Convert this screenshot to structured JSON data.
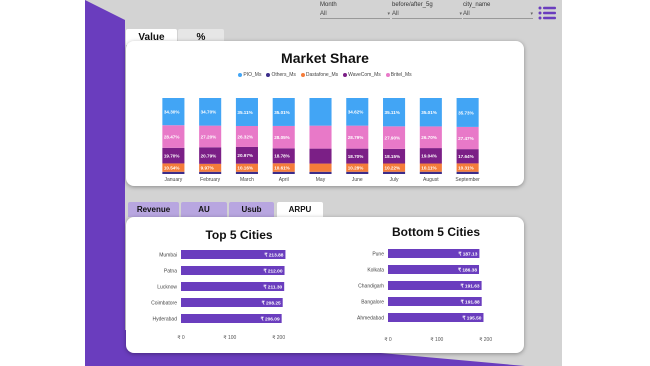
{
  "filters": [
    {
      "label": "Month",
      "value": "All"
    },
    {
      "label": "before/after_5g",
      "value": "All"
    },
    {
      "label": "city_name",
      "value": "All"
    }
  ],
  "top_tabs": [
    "Value",
    "%"
  ],
  "bottom_tabs": [
    "Revenue",
    "AU",
    "Usub",
    "ARPU"
  ],
  "colors": {
    "purple": "#6a3dbe",
    "bar": "#6a3dbe",
    "pio": "#42a5f5",
    "others": "#3b2d8a",
    "dastafone": "#f57c3a",
    "wavecom": "#7b1f86",
    "britel": "#e879c8"
  },
  "chart_data": [
    {
      "type": "bar",
      "title": "Market Share",
      "stacked": true,
      "legend_position": "top",
      "categories": [
        "January",
        "February",
        "March",
        "April",
        "May",
        "June",
        "July",
        "August",
        "September"
      ],
      "series": [
        {
          "name": "PIO_Ms",
          "color": "#42a5f5",
          "values": [
            34.3,
            34.7,
            35.11,
            35.01,
            34.7,
            34.62,
            35.11,
            35.01,
            35.73
          ]
        },
        {
          "name": "Others_Ms",
          "color": "#3b2d8a",
          "values": [
            2.79,
            2.79,
            2.79,
            2.79,
            2.79,
            2.79,
            2.79,
            2.79,
            2.79
          ]
        },
        {
          "name": "Dastafone_Ms",
          "color": "#f57c3a",
          "values": [
            10.54,
            9.97,
            10.16,
            10.61,
            10.28,
            10.28,
            10.22,
            10.11,
            10.31
          ]
        },
        {
          "name": "WaveCom_Ms",
          "color": "#7b1f86",
          "values": [
            19.7,
            20.79,
            20.97,
            18.78,
            18.78,
            18.7,
            18.15,
            19.04,
            17.64
          ]
        },
        {
          "name": "Britel_Ms",
          "color": "#e879c8",
          "values": [
            28.47,
            27.2,
            26.32,
            28.05,
            28.79,
            28.79,
            27.9,
            26.7,
            27.47
          ]
        }
      ],
      "data_labels": [
        [
          "34.30%",
          "28.47%",
          "19.70%",
          "10.54%"
        ],
        [
          "34.70%",
          "27.20%",
          "20.79%",
          "9.97%"
        ],
        [
          "35.11%",
          "26.32%",
          "20.97%",
          "10.16%"
        ],
        [
          "35.01%",
          "28.05%",
          "18.78%",
          "10.61%"
        ],
        [
          "",
          "",
          "",
          ""
        ],
        [
          "34.62%",
          "28.79%",
          "18.70%",
          "10.28%"
        ],
        [
          "35.11%",
          "27.90%",
          "18.15%",
          "10.22%"
        ],
        [
          "35.01%",
          "26.70%",
          "19.04%",
          "10.11%"
        ],
        [
          "35.73%",
          "27.47%",
          "17.64%",
          "10.31%"
        ]
      ]
    },
    {
      "type": "bar",
      "orientation": "horizontal",
      "title": "Top 5 Cities",
      "categories": [
        "Mumbai",
        "Patna",
        "Lucknow",
        "Coimbatore",
        "Hyderabad"
      ],
      "values": [
        213.88,
        212.0,
        211.3,
        208.25,
        206.09
      ],
      "value_labels": [
        "₹ 213.88",
        "₹ 212.00",
        "₹ 211.30",
        "₹ 208.25",
        "₹ 206.09"
      ],
      "xticks": [
        "₹ 0",
        "₹ 100",
        "₹ 200"
      ],
      "xlim": [
        0,
        215
      ]
    },
    {
      "type": "bar",
      "orientation": "horizontal",
      "title": "Bottom 5 Cities",
      "categories": [
        "Pune",
        "Kolkata",
        "Chandigarh",
        "Bangalore",
        "Ahmedabad"
      ],
      "values": [
        187.13,
        186.38,
        191.63,
        191.88,
        195.5
      ],
      "value_labels": [
        "₹ 187.13",
        "₹ 186.38",
        "₹ 191.63",
        "₹ 191.88",
        "₹ 195.50"
      ],
      "xticks": [
        "₹ 0",
        "₹ 100",
        "₹ 200"
      ],
      "xlim": [
        0,
        215
      ]
    }
  ]
}
